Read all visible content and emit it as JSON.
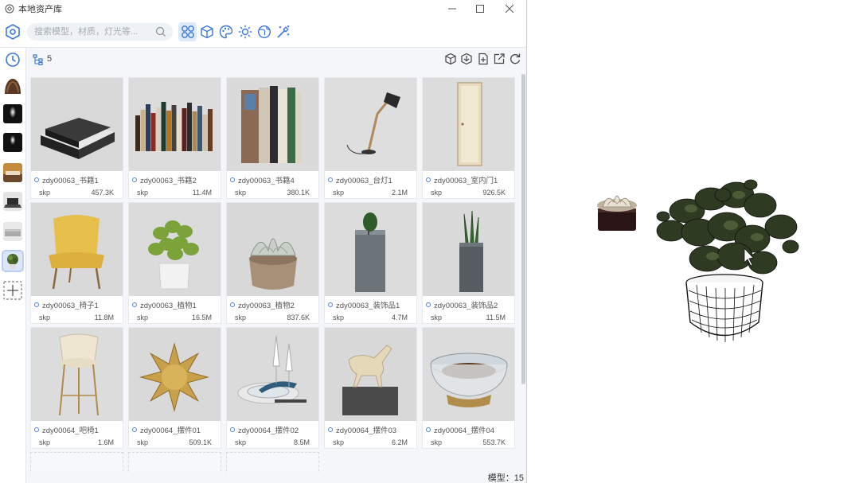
{
  "window": {
    "title": "本地资产库",
    "controls": {
      "minimize": "—",
      "maximize": "☐",
      "close": "✕"
    }
  },
  "search": {
    "placeholder": "搜索模型，材质，灯光等..."
  },
  "categories": [
    {
      "icon": "model-grid-icon",
      "active": true
    },
    {
      "icon": "cube-icon",
      "active": false
    },
    {
      "icon": "palette-icon",
      "active": false
    },
    {
      "icon": "sun-light-icon",
      "active": false
    },
    {
      "icon": "globe-environment-icon",
      "active": false
    },
    {
      "icon": "magic-wand-icon",
      "active": false
    }
  ],
  "sidebar": [
    {
      "icon": "history-clock-icon"
    },
    {
      "icon": "texture-thumb-icon"
    },
    {
      "icon": "dark-light-thumb-icon"
    },
    {
      "icon": "dark-light-thumb-icon"
    },
    {
      "icon": "room-thumb-icon"
    },
    {
      "icon": "laptop-thumb-icon"
    },
    {
      "icon": "gray-box-thumb-icon"
    },
    {
      "icon": "plant-thumb-icon",
      "active": true
    },
    {
      "icon": "add-collection-icon"
    }
  ],
  "subbar": {
    "count": "5"
  },
  "assets": [
    {
      "name": "zdy00063_书籍1",
      "format": "skp",
      "size": "457.3K",
      "kind": "books-stack",
      "bg": "#d9d9d9"
    },
    {
      "name": "zdy00063_书籍2",
      "format": "skp",
      "size": "11.4M",
      "kind": "books-row",
      "bg": "#dcdcdc"
    },
    {
      "name": "zdy00063_书籍4",
      "format": "skp",
      "size": "380.1K",
      "kind": "books-tall",
      "bg": "#dadada"
    },
    {
      "name": "zdy00063_台灯1",
      "format": "skp",
      "size": "2.1M",
      "kind": "lamp",
      "bg": "#dedede"
    },
    {
      "name": "zdy00063_室内门1",
      "format": "skp",
      "size": "926.5K",
      "kind": "door",
      "bg": "#dcdcdc"
    },
    {
      "name": "zdy00063_椅子1",
      "format": "skp",
      "size": "11.8M",
      "kind": "chair",
      "bg": "#d9d9d9"
    },
    {
      "name": "zdy00063_植物1",
      "format": "skp",
      "size": "16.5M",
      "kind": "plant",
      "bg": "#dbdbdb"
    },
    {
      "name": "zdy00063_植物2",
      "format": "skp",
      "size": "837.6K",
      "kind": "succulent",
      "bg": "#d8d8d8"
    },
    {
      "name": "zdy00063_装饰品1",
      "format": "skp",
      "size": "4.7M",
      "kind": "vase-cactus",
      "bg": "#dcdcdc"
    },
    {
      "name": "zdy00063_装饰品2",
      "format": "skp",
      "size": "11.5M",
      "kind": "vase-snake",
      "bg": "#dadada"
    },
    {
      "name": "zdy00064_吧椅1",
      "format": "skp",
      "size": "1.6M",
      "kind": "barstool",
      "bg": "#dcdcdc"
    },
    {
      "name": "zdy00064_摆件01",
      "format": "skp",
      "size": "509.1K",
      "kind": "spiky",
      "bg": "#d9d9d9"
    },
    {
      "name": "zdy00064_摆件02",
      "format": "skp",
      "size": "8.5M",
      "kind": "tableware",
      "bg": "#dbdbdb"
    },
    {
      "name": "zdy00064_摆件03",
      "format": "skp",
      "size": "6.2M",
      "kind": "horse",
      "bg": "#d8d8d8"
    },
    {
      "name": "zdy00064_摆件04",
      "format": "skp",
      "size": "553.7K",
      "kind": "glass-bowl",
      "bg": "#dcdcdc"
    }
  ],
  "status": {
    "text": "模型：15"
  }
}
